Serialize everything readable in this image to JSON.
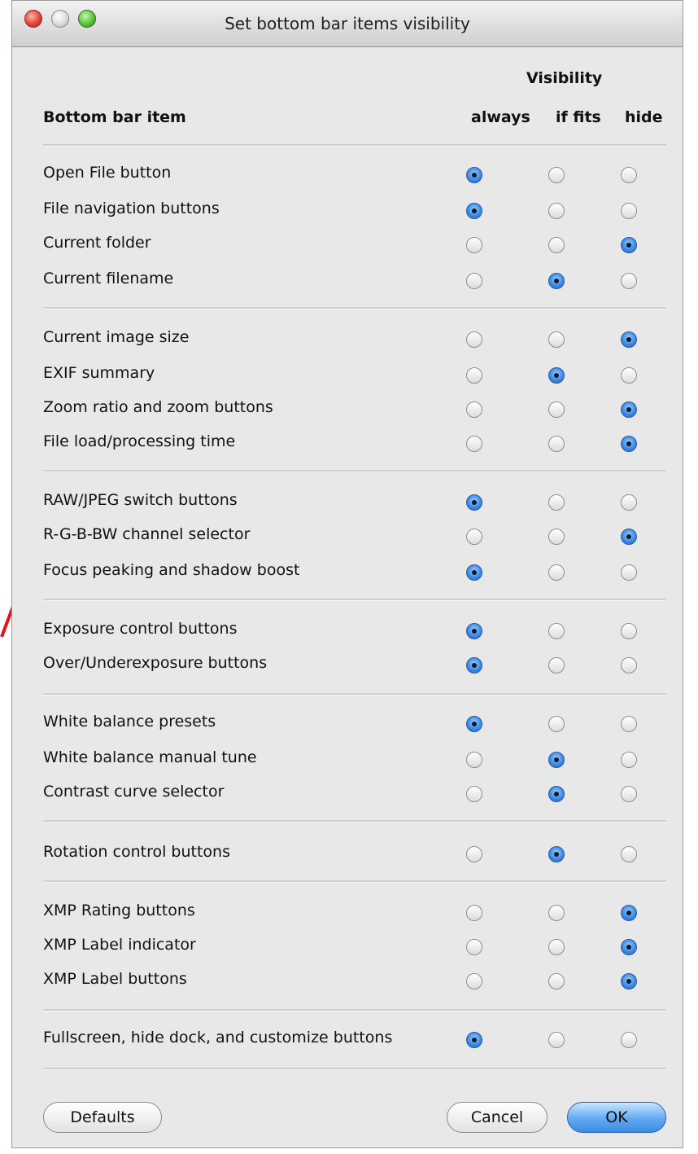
{
  "window": {
    "title": "Set bottom bar items visibility"
  },
  "header": {
    "visibility_title": "Visibility",
    "item_column": "Bottom bar item",
    "options": [
      "always",
      "if fits",
      "hide"
    ]
  },
  "groups": [
    {
      "rows": [
        {
          "label": "Open File button",
          "selected": "always"
        },
        {
          "label": "File navigation buttons",
          "selected": "always"
        },
        {
          "label": "Current folder",
          "selected": "hide"
        },
        {
          "label": "Current filename",
          "selected": "if fits"
        }
      ]
    },
    {
      "rows": [
        {
          "label": "Current image size",
          "selected": "hide"
        },
        {
          "label": "EXIF summary",
          "selected": "if fits"
        },
        {
          "label": "Zoom ratio and zoom buttons",
          "selected": "hide"
        },
        {
          "label": "File load/processing time",
          "selected": "hide"
        }
      ]
    },
    {
      "rows": [
        {
          "label": "RAW/JPEG switch buttons",
          "selected": "always"
        },
        {
          "label": "R-G-B-BW channel selector",
          "selected": "hide"
        },
        {
          "label": "Focus peaking and shadow boost",
          "selected": "always"
        }
      ]
    },
    {
      "rows": [
        {
          "label": "Exposure control buttons",
          "selected": "always"
        },
        {
          "label": "Over/Underexposure buttons",
          "selected": "always"
        }
      ]
    },
    {
      "rows": [
        {
          "label": "White balance presets",
          "selected": "always"
        },
        {
          "label": "White balance manual tune",
          "selected": "if fits"
        },
        {
          "label": "Contrast curve selector",
          "selected": "if fits"
        }
      ]
    },
    {
      "rows": [
        {
          "label": "Rotation control buttons",
          "selected": "if fits"
        }
      ]
    },
    {
      "rows": [
        {
          "label": "XMP Rating buttons",
          "selected": "hide"
        },
        {
          "label": "XMP Label indicator",
          "selected": "hide"
        },
        {
          "label": "XMP Label buttons",
          "selected": "hide"
        }
      ]
    },
    {
      "rows": [
        {
          "label": "Fullscreen, hide dock, and customize buttons",
          "selected": "always"
        }
      ]
    }
  ],
  "buttons": {
    "defaults": "Defaults",
    "cancel": "Cancel",
    "ok": "OK"
  },
  "colors": {
    "radio_selected": "#3f8ae4",
    "annotation_arrow": "#e0141e"
  }
}
